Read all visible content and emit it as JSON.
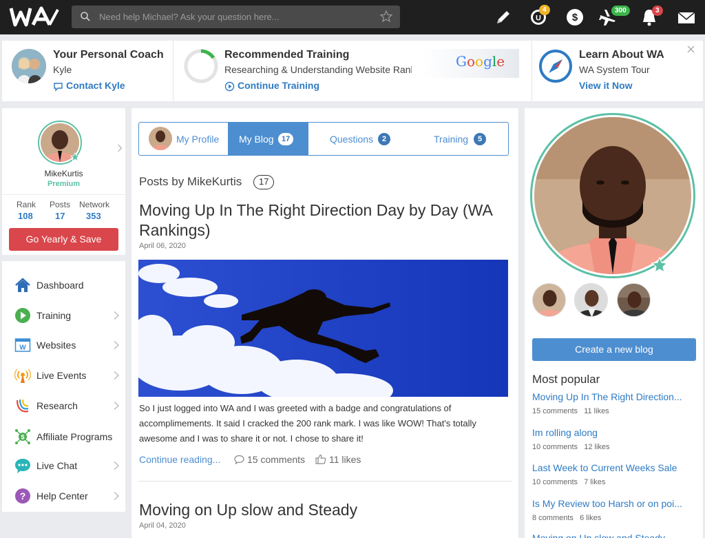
{
  "search": {
    "placeholder": "Need help Michael? Ask your question here..."
  },
  "topbar": {
    "badges": {
      "rank": "4",
      "flights": "300",
      "notifications": "3"
    },
    "colors": {
      "rank_badge": "#f0b429",
      "flights_badge": "#3bb44a",
      "notif_badge": "#d9464b"
    }
  },
  "coach": {
    "title": "Your Personal Coach",
    "name": "Kyle",
    "link": "Contact Kyle"
  },
  "training": {
    "title": "Recommended Training",
    "subtitle": "Researching & Understanding Website Rank",
    "link": "Continue Training",
    "logo_text": "Google"
  },
  "learn": {
    "title": "Learn About WA",
    "subtitle": "WA System Tour",
    "link": "View it Now"
  },
  "profile": {
    "username": "MikeKurtis",
    "membership": "Premium",
    "stats": [
      {
        "label": "Rank",
        "value": "108"
      },
      {
        "label": "Posts",
        "value": "17"
      },
      {
        "label": "Network",
        "value": "353"
      }
    ],
    "cta": "Go Yearly & Save"
  },
  "nav": [
    {
      "label": "Dashboard",
      "icon": "house-icon"
    },
    {
      "label": "Training",
      "icon": "play-icon"
    },
    {
      "label": "Websites",
      "icon": "website-icon"
    },
    {
      "label": "Live Events",
      "icon": "broadcast-icon"
    },
    {
      "label": "Research",
      "icon": "research-icon"
    },
    {
      "label": "Affiliate Programs",
      "icon": "affiliate-icon"
    },
    {
      "label": "Live Chat",
      "icon": "chat-icon"
    },
    {
      "label": "Help Center",
      "icon": "help-icon"
    }
  ],
  "tabs": [
    {
      "label": "My Profile"
    },
    {
      "label": "My Blog",
      "count": "17"
    },
    {
      "label": "Questions",
      "count": "2"
    },
    {
      "label": "Training",
      "count": "5"
    }
  ],
  "posts_header": {
    "label": "Posts by MikeKurtis",
    "count": "17"
  },
  "posts": [
    {
      "title": "Moving Up In The Right Direction Day by Day (WA Rankings)",
      "date": "April 06, 2020",
      "excerpt": "So I just logged into WA and I was greeted with a badge and congratulations of accomplimements. It said I cracked the 200 rank mark. I was like WOW! That's totally awesome and I was to share it or not. I chose to share it!",
      "read_more": "Continue reading...",
      "comments": "15 comments",
      "likes": "11 likes"
    },
    {
      "title": "Moving on Up slow and Steady",
      "date": "April 04, 2020"
    }
  ],
  "sidebar_right": {
    "create_button": "Create a new blog",
    "popular_heading": "Most popular",
    "popular": [
      {
        "title": "Moving Up In The Right Direction...",
        "comments": "15 comments",
        "likes": "11 likes"
      },
      {
        "title": "Im rolling along",
        "comments": "10 comments",
        "likes": "12 likes"
      },
      {
        "title": "Last Week to Current Weeks Sale",
        "comments": "10 comments",
        "likes": "7 likes"
      },
      {
        "title": "Is My Review too Harsh or on poi...",
        "comments": "8 comments",
        "likes": "6 likes"
      },
      {
        "title": "Moving on Up slow and Steady"
      }
    ]
  }
}
